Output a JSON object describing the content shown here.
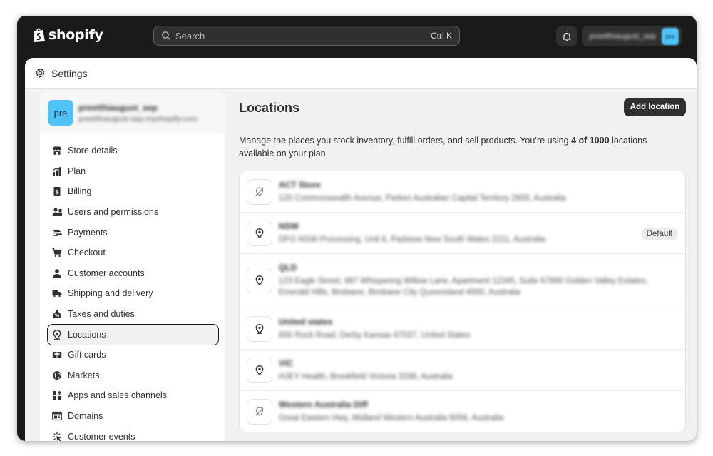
{
  "topbar": {
    "logo_text": "shopify",
    "search": {
      "placeholder": "Search",
      "shortcut": "Ctrl K"
    },
    "account": {
      "name": "preetthiaugust_sep",
      "avatar": "pre"
    }
  },
  "settings": {
    "title": "Settings"
  },
  "store": {
    "avatar": "pre",
    "name": "preetthiaugust_sep",
    "domain": "preetthiaugust-sep.myshopify.com"
  },
  "sidebar": {
    "items": [
      {
        "label": "Store details",
        "icon": "store-icon"
      },
      {
        "label": "Plan",
        "icon": "chart-icon"
      },
      {
        "label": "Billing",
        "icon": "billing-icon"
      },
      {
        "label": "Users and permissions",
        "icon": "users-icon"
      },
      {
        "label": "Payments",
        "icon": "payments-icon"
      },
      {
        "label": "Checkout",
        "icon": "cart-icon"
      },
      {
        "label": "Customer accounts",
        "icon": "person-icon"
      },
      {
        "label": "Shipping and delivery",
        "icon": "truck-icon"
      },
      {
        "label": "Taxes and duties",
        "icon": "tax-icon"
      },
      {
        "label": "Locations",
        "icon": "location-icon"
      },
      {
        "label": "Gift cards",
        "icon": "gift-icon"
      },
      {
        "label": "Markets",
        "icon": "globe-icon"
      },
      {
        "label": "Apps and sales channels",
        "icon": "apps-icon"
      },
      {
        "label": "Domains",
        "icon": "domain-icon"
      },
      {
        "label": "Customer events",
        "icon": "events-icon"
      }
    ]
  },
  "main": {
    "title": "Locations",
    "add_button": "Add location",
    "description": {
      "before": "Manage the places you stock inventory, fulfill orders, and sell products. You’re using ",
      "bold": "4 of 1000",
      "after": " locations available on your plan."
    },
    "locations": [
      {
        "name": "ACT Store",
        "address": "120 Commonwealth Avenue, Parkes Australian Capital Territory 2600, Australia",
        "icon": "location-off-icon"
      },
      {
        "name": "NSW",
        "address": "DFG NSW Processing, Unit 6, Padstow New South Wales 2211, Australia",
        "icon": "location-icon",
        "badge": "Default"
      },
      {
        "name": "QLD",
        "address": "123 Eagle Street, 987 Whispering Willow Lane, Apartment 12345, Suite 67890 Golden Valley Estates, Emerald Hills, Brisbane, Brisbane City Queensland 4000, Australia",
        "icon": "location-icon"
      },
      {
        "name": "United states",
        "address": "600 Rock Road, Derby Kansas 67037, United States",
        "icon": "location-icon"
      },
      {
        "name": "VIC",
        "address": "HJEY Health, Brookfield Victoria 3338, Australia",
        "icon": "location-icon"
      },
      {
        "name": "Western Australia Diff",
        "address": "Great Eastern Hwy, Midland Western Australia 6056, Australia",
        "icon": "location-off-icon"
      }
    ]
  },
  "colors": {
    "topbar": "#1a1a1a",
    "avatar": "#4fc3f7",
    "panel_bg": "#f1f1f1",
    "button_dark": "#303030"
  }
}
